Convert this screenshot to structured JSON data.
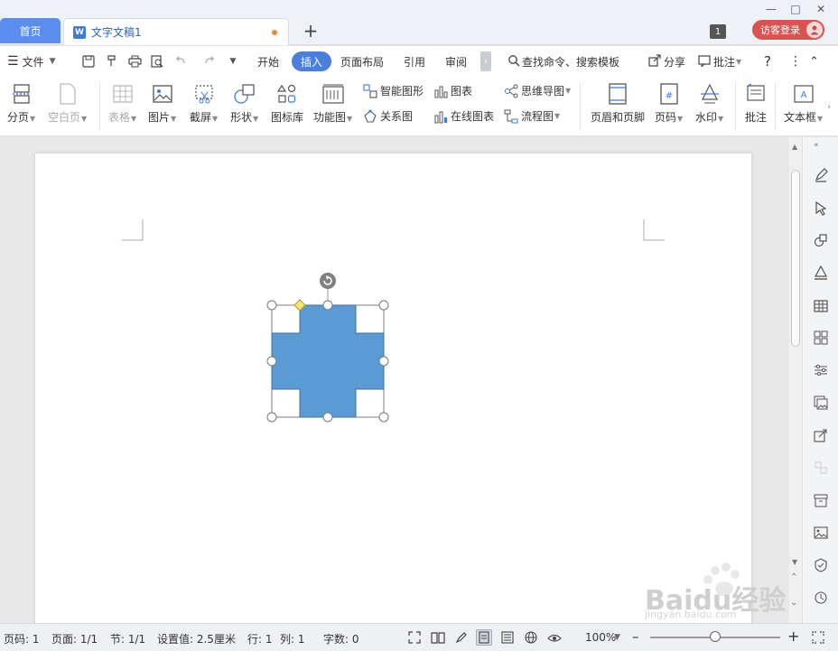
{
  "tabs": {
    "home": "首页",
    "doc": "文字文稿1",
    "doc_icon": "W",
    "badge": "1",
    "guest": "访客登录"
  },
  "menu": {
    "file": "文件",
    "tabs": [
      "开始",
      "插入",
      "页面布局",
      "引用",
      "审阅"
    ],
    "active_tab": "插入",
    "search": "查找命令、搜索模板",
    "share": "分享",
    "comment": "批注"
  },
  "ribbon": {
    "page_break": "分页",
    "blank_page": "空白页",
    "table": "表格",
    "picture": "图片",
    "screenshot": "截屏",
    "shape": "形状",
    "icon_lib": "图标库",
    "function_chart": "功能图",
    "smart_shape": "智能图形",
    "relation_chart": "关系图",
    "chart": "图表",
    "online_chart": "在线图表",
    "mind_map": "思维导图",
    "flow_chart": "流程图",
    "header_footer": "页眉和页脚",
    "page_num": "页码",
    "watermark": "水印",
    "comment": "批注",
    "textbox": "文本框"
  },
  "status": {
    "page_code": "页码: 1",
    "pages": "页面: 1/1",
    "section": "节: 1/1",
    "setting": "设置值: 2.5厘米",
    "row": "行: 1",
    "col": "列: 1",
    "words": "字数: 0",
    "zoom": "100%"
  },
  "colors": {
    "accent": "#4a7fe0",
    "shape_fill": "#5b9bd5",
    "guest_btn": "#d9534f"
  },
  "watermark": {
    "brand": "Baidu经验",
    "url": "jingyan.baidu.com"
  }
}
